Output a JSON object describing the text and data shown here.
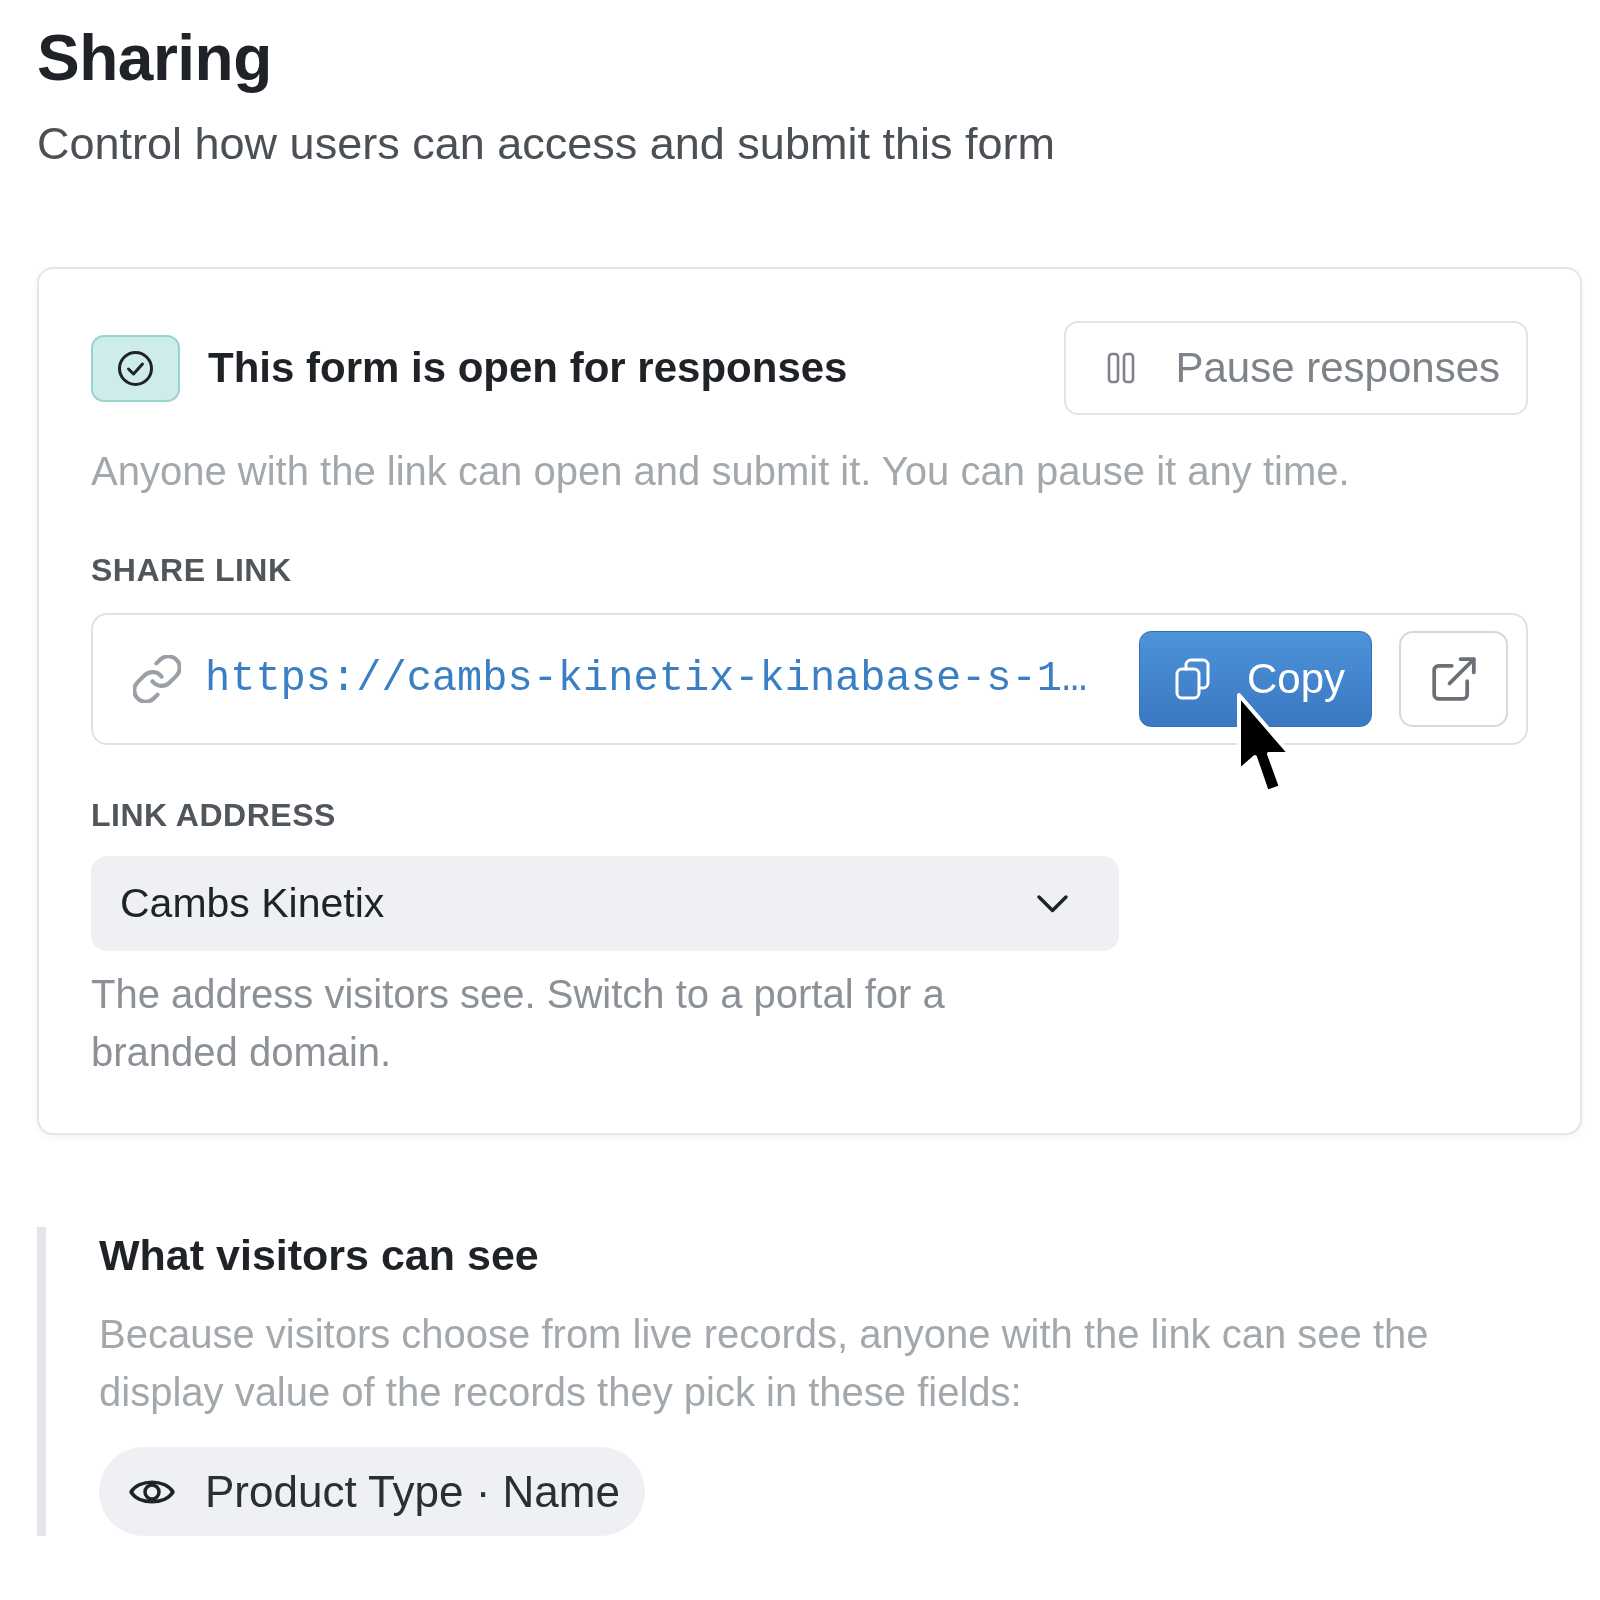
{
  "header": {
    "title": "Sharing",
    "subtitle": "Control how users can access and submit this form"
  },
  "status": {
    "open": true,
    "label": "This form is open for responses",
    "action": "Pause responses",
    "description": "Anyone with the link can open and submit it. You can pause it any time."
  },
  "share_link": {
    "label": "SHARE LINK",
    "url": "https://cambs-kinetix-kinabase-s-1…",
    "copy_button": "Copy"
  },
  "link_address": {
    "label": "LINK ADDRESS",
    "value": "Cambs Kinetix",
    "help": "The address visitors see. Switch to a portal for a branded domain."
  },
  "visibility": {
    "title": "What visitors can see",
    "description": "Because visitors choose from live records, anyone with the link can see the display value of the records they pick in these fields:",
    "fields": [
      "Product Type · Name"
    ]
  }
}
